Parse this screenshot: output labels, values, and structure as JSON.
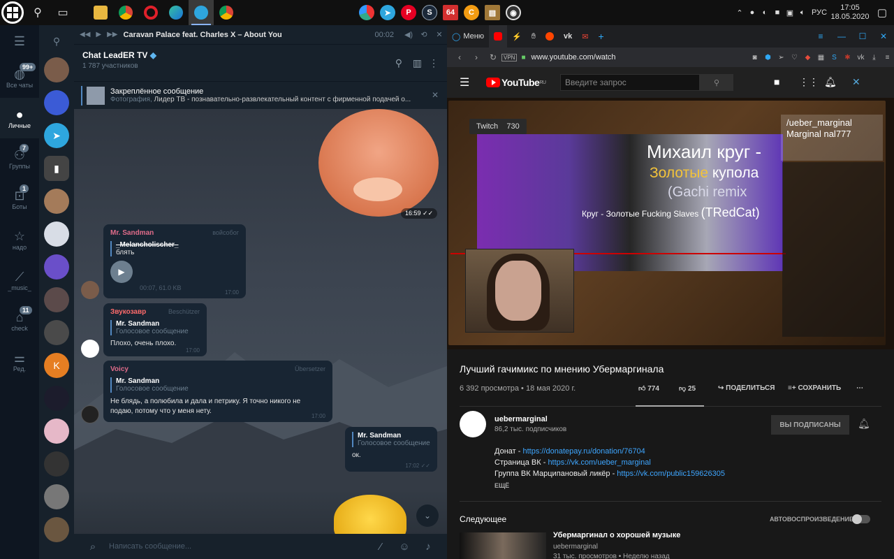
{
  "taskbar": {
    "clock_time": "17:05",
    "clock_date": "18.05.2020",
    "lang": "РУС",
    "center_badge": "64"
  },
  "telegram": {
    "folders": [
      {
        "label": "Все чаты",
        "badge": "99+",
        "icon": "chat-bubbles-icon"
      },
      {
        "label": "Личные",
        "badge": "",
        "icon": "person-icon"
      },
      {
        "label": "Группы",
        "badge": "7",
        "icon": "group-icon"
      },
      {
        "label": "Боты",
        "badge": "1",
        "icon": "robot-icon"
      },
      {
        "label": "надо",
        "badge": "",
        "icon": "star-icon"
      },
      {
        "label": "_music_",
        "badge": "",
        "icon": "chart-icon"
      },
      {
        "label": "check",
        "badge": "11",
        "icon": "home-icon"
      },
      {
        "label": "Ред.",
        "badge": "",
        "icon": "sliders-icon"
      }
    ],
    "player": {
      "track": "Caravan Palace feat. Charles X – About You",
      "time": "00:02"
    },
    "chat": {
      "name": "Chat LeadER TV",
      "members": "1 787 участников"
    },
    "pinned": {
      "title": "Закреплённое сообщение",
      "kind": "Фотография,",
      "text": "Лидер ТВ - познавательно-развлекательный контент с фирменной подачей о..."
    },
    "sticker_time": "16:59",
    "messages": [
      {
        "author": "Mr. Sandman",
        "tag": "войсобог",
        "reply_name": "_Melancholischer_",
        "reply_text": "блять",
        "voice_meta": "00:07, 61.0 KB",
        "time": "17:00"
      },
      {
        "author": "Звукозавр",
        "tag": "Beschützer",
        "reply_name": "Mr. Sandman",
        "reply_text": "Голосовое сообщение",
        "text": "Плохо, очень плохо.",
        "time": "17:00"
      },
      {
        "author": "Voicy",
        "tag": "Übersetzer",
        "reply_name": "Mr. Sandman",
        "reply_text": "Голосовое сообщение",
        "text": "Не блядь, а полюбила и дала и петрику. Я точно никого не подаю, потому что у меня нету.",
        "time": "17:00"
      },
      {
        "reply_name": "Mr. Sandman",
        "reply_text": "Голосовое сообщение",
        "text": "ок.",
        "time": "17:02"
      }
    ],
    "input_placeholder": "Написать сообщение..."
  },
  "browser": {
    "tab_menu": "Меню",
    "url": "www.youtube.com/watch",
    "youtube": {
      "search_placeholder": "Введите запрос",
      "logo": "YouTube",
      "logo_region": "RU",
      "video": {
        "twitch_label": "Twitch",
        "twitch_count": "730",
        "vk_text": "/ueber_marginal Marginal nal777",
        "title_line1": "Михаил круг -",
        "title_line2a": "Золотые",
        "title_line2b": "купола",
        "title_line3": "(Gachi remix",
        "title_line4a": "Круг - Золотые Fucking Slaves",
        "title_line4b": "(TRedCat)"
      },
      "title": "Лучший гачимикс по мнению Убермаргинала",
      "views": "6 392 просмотра • 18 мая 2020 г.",
      "likes": "774",
      "dislikes": "25",
      "share": "ПОДЕЛИТЬСЯ",
      "save": "СОХРАНИТЬ",
      "channel": {
        "name": "uebermarginal",
        "subs": "86,2 тыс. подписчиков",
        "subscribed": "ВЫ ПОДПИСАНЫ",
        "desc1_label": "Донат - ",
        "desc1_link": "https://donatepay.ru/donation/76704",
        "desc2_label": "Страница ВК - ",
        "desc2_link": "https://vk.com/ueber_marginal",
        "desc3_label": "Группа ВК Марципановый ликёр - ",
        "desc3_link": "https://vk.com/public159626305",
        "more": "ЕЩЁ"
      },
      "next": {
        "heading": "Следующее",
        "autoplay": "АВТОВОСПРОИЗВЕДЕНИЕ",
        "video_title": "Убермаргинал о хорошей музыке",
        "video_channel": "uebermarginal",
        "video_stats": "31 тыс. просмотров • Неделю назад"
      }
    }
  }
}
